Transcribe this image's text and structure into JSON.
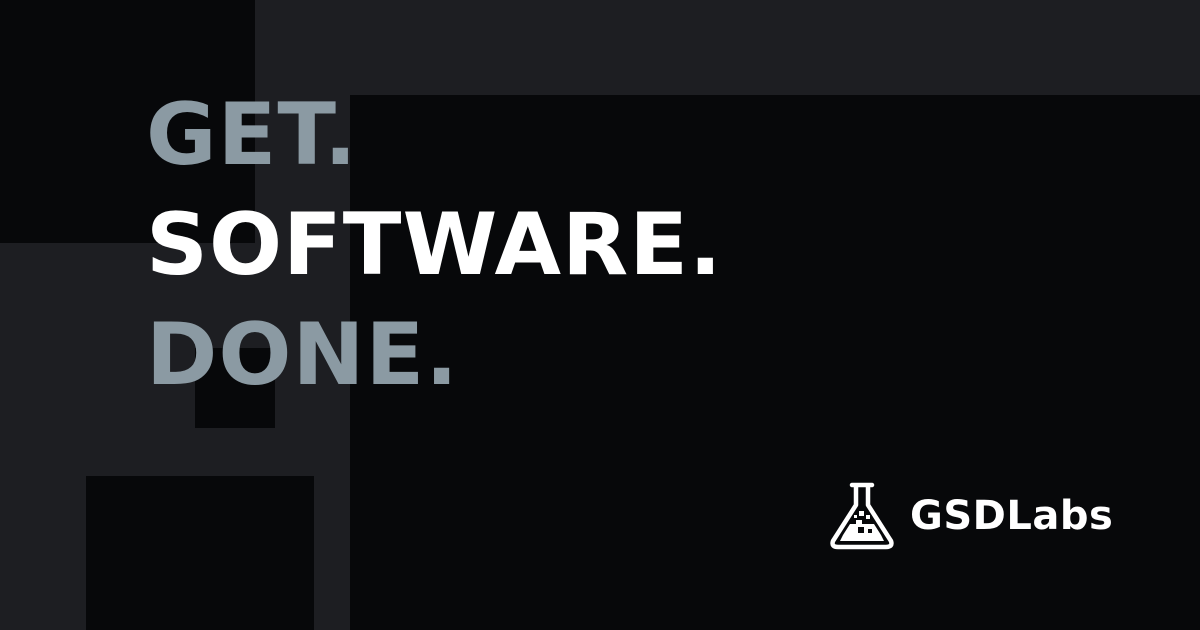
{
  "headline": {
    "line1": "GET.",
    "line2": "SOFTWARE.",
    "line3": "DONE."
  },
  "brand": {
    "name": "GSDLabs",
    "icon": "flask-icon"
  },
  "colors": {
    "background": "#07080a",
    "panel": "#1d1e22",
    "accent_text": "#8b9aa3",
    "primary_text": "#ffffff"
  }
}
